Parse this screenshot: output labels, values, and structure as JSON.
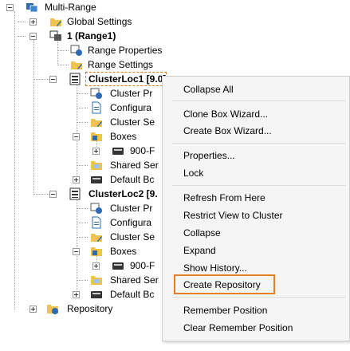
{
  "tree": {
    "root": "Multi-Range",
    "global_settings": "Global Settings",
    "range1": "1 (Range1)",
    "range_properties": "Range Properties",
    "range_settings": "Range Settings",
    "cluster1": "ClusterLoc1 [9.0]",
    "c1_cluster_props": "Cluster Pr",
    "c1_configuration": "Configura",
    "c1_cluster_settings": "Cluster Se",
    "c1_boxes": "Boxes",
    "c1_box_900": "900-F",
    "c1_shared": "Shared Ser",
    "c1_default_box": "Default Bc",
    "cluster2": "ClusterLoc2 [9.",
    "c2_cluster_props": "Cluster Pr",
    "c2_configuration": "Configura",
    "c2_cluster_settings": "Cluster Se",
    "c2_boxes": "Boxes",
    "c2_box_900": "900-F",
    "c2_shared": "Shared Ser",
    "c2_default_box": "Default Bc",
    "repository": "Repository"
  },
  "menu": {
    "collapse_all": "Collapse All",
    "clone_box_wizard": "Clone Box Wizard...",
    "create_box_wizard": "Create Box Wizard...",
    "properties": "Properties...",
    "lock": "Lock",
    "refresh_from_here": "Refresh From Here",
    "restrict_view": "Restrict View to Cluster",
    "collapse": "Collapse",
    "expand": "Expand",
    "show_history": "Show History...",
    "create_repository": "Create Repository",
    "remember_position": "Remember Position",
    "clear_remember_position": "Clear Remember Position"
  },
  "colors": {
    "highlight": "#e67e22",
    "folder": "#f2c14e",
    "blue_icon": "#2b6cb0"
  }
}
